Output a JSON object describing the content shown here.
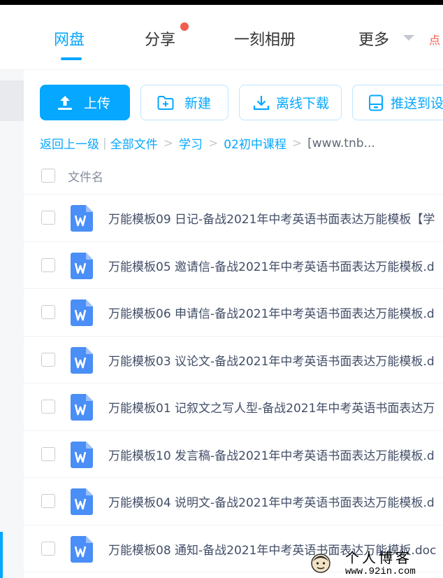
{
  "nav": {
    "items": [
      {
        "label": "网盘",
        "active": true
      },
      {
        "label": "分享",
        "active": false,
        "badge": "red-dot"
      },
      {
        "label": "一刻相册",
        "active": false
      },
      {
        "label": "更多",
        "active": false
      }
    ],
    "cut_text": "点"
  },
  "toolbar": {
    "upload_label": "上传",
    "new_label": "新建",
    "offline_label": "离线下载",
    "push_label": "推送到设"
  },
  "breadcrumb": {
    "back": "返回上一级",
    "all": "全部文件",
    "level1": "学习",
    "level2": "02初中课程",
    "current": "[www.tnb..."
  },
  "table": {
    "column_name": "文件名"
  },
  "files": [
    {
      "name": "万能模板09 日记-备战2021年中考英语书面表达万能模板【学",
      "icon": "word-doc-icon"
    },
    {
      "name": "万能模板05 邀请信-备战2021年中考英语书面表达万能模板.d",
      "icon": "word-doc-icon"
    },
    {
      "name": "万能模板06 申请信-备战2021年中考英语书面表达万能模板.d",
      "icon": "word-doc-icon"
    },
    {
      "name": "万能模板03 议论文-备战2021年中考英语书面表达万能模板.d",
      "icon": "word-doc-icon"
    },
    {
      "name": "万能模板01 记叙文之写人型-备战2021年中考英语书面表达万",
      "icon": "word-doc-icon"
    },
    {
      "name": "万能模板10 发言稿-备战2021年中考英语书面表达万能模板.d",
      "icon": "word-doc-icon"
    },
    {
      "name": "万能模板04 说明文-备战2021年中考英语书面表达万能模板.d",
      "icon": "word-doc-icon"
    },
    {
      "name": "万能模板08 通知-备战2021年中考英语书面表达万能模板.doc",
      "icon": "word-doc-icon"
    }
  ],
  "watermark": {
    "title": "个人博客",
    "url": "www.92in.com"
  },
  "colors": {
    "accent": "#06a7ff",
    "badge": "#f25d4e",
    "text": "#424e67",
    "word_icon": "#4a8ef7"
  }
}
